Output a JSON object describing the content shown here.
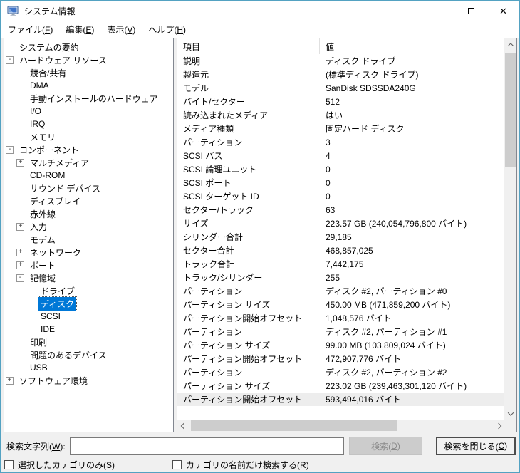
{
  "window": {
    "title": "システム情報",
    "close_glyph": "✕"
  },
  "menubar": {
    "items": [
      {
        "label": "ファイル(F)"
      },
      {
        "label": "編集(E)"
      },
      {
        "label": "表示(V)"
      },
      {
        "label": "ヘルプ(H)"
      }
    ]
  },
  "tree": {
    "items": [
      {
        "label": "システムの要約",
        "level": 0,
        "expander": ""
      },
      {
        "label": "ハードウェア リソース",
        "level": 0,
        "expander": "-"
      },
      {
        "label": "競合/共有",
        "level": 1,
        "expander": ""
      },
      {
        "label": "DMA",
        "level": 1,
        "expander": ""
      },
      {
        "label": "手動インストールのハードウェア",
        "level": 1,
        "expander": ""
      },
      {
        "label": "I/O",
        "level": 1,
        "expander": ""
      },
      {
        "label": "IRQ",
        "level": 1,
        "expander": ""
      },
      {
        "label": "メモリ",
        "level": 1,
        "expander": ""
      },
      {
        "label": "コンポーネント",
        "level": 0,
        "expander": "-"
      },
      {
        "label": "マルチメディア",
        "level": 1,
        "expander": "+"
      },
      {
        "label": "CD-ROM",
        "level": 1,
        "expander": ""
      },
      {
        "label": "サウンド デバイス",
        "level": 1,
        "expander": ""
      },
      {
        "label": "ディスプレイ",
        "level": 1,
        "expander": ""
      },
      {
        "label": "赤外線",
        "level": 1,
        "expander": ""
      },
      {
        "label": "入力",
        "level": 1,
        "expander": "+"
      },
      {
        "label": "モデム",
        "level": 1,
        "expander": ""
      },
      {
        "label": "ネットワーク",
        "level": 1,
        "expander": "+"
      },
      {
        "label": "ポート",
        "level": 1,
        "expander": "+"
      },
      {
        "label": "記憶域",
        "level": 1,
        "expander": "-"
      },
      {
        "label": "ドライブ",
        "level": 2,
        "expander": ""
      },
      {
        "label": "ディスク",
        "level": 2,
        "expander": "",
        "selected": true
      },
      {
        "label": "SCSI",
        "level": 2,
        "expander": ""
      },
      {
        "label": "IDE",
        "level": 2,
        "expander": ""
      },
      {
        "label": "印刷",
        "level": 1,
        "expander": ""
      },
      {
        "label": "問題のあるデバイス",
        "level": 1,
        "expander": ""
      },
      {
        "label": "USB",
        "level": 1,
        "expander": ""
      },
      {
        "label": "ソフトウェア環境",
        "level": 0,
        "expander": "+"
      }
    ]
  },
  "details": {
    "header": {
      "item": "項目",
      "value": "値"
    },
    "rows": [
      {
        "item": "説明",
        "value": "ディスク ドライブ"
      },
      {
        "item": "製造元",
        "value": "(標準ディスク ドライブ)"
      },
      {
        "item": "モデル",
        "value": "SanDisk SDSSDA240G"
      },
      {
        "item": "バイト/セクター",
        "value": "512"
      },
      {
        "item": "読み込まれたメディア",
        "value": "はい"
      },
      {
        "item": "メディア種類",
        "value": "固定ハード ディスク"
      },
      {
        "item": "パーティション",
        "value": "3"
      },
      {
        "item": "SCSI バス",
        "value": "4"
      },
      {
        "item": "SCSI 論理ユニット",
        "value": "0"
      },
      {
        "item": "SCSI ポート",
        "value": "0"
      },
      {
        "item": "SCSI ターゲット ID",
        "value": "0"
      },
      {
        "item": "セクター/トラック",
        "value": "63"
      },
      {
        "item": "サイズ",
        "value": "223.57 GB (240,054,796,800 バイト)"
      },
      {
        "item": "シリンダー合計",
        "value": "29,185"
      },
      {
        "item": "セクター合計",
        "value": "468,857,025"
      },
      {
        "item": "トラック合計",
        "value": "7,442,175"
      },
      {
        "item": "トラック/シリンダー",
        "value": "255"
      },
      {
        "item": "パーティション",
        "value": "ディスク #2, パーティション #0"
      },
      {
        "item": "パーティション サイズ",
        "value": "450.00 MB (471,859,200 バイト)"
      },
      {
        "item": "パーティション開始オフセット",
        "value": "1,048,576 バイト"
      },
      {
        "item": "パーティション",
        "value": "ディスク #2, パーティション #1"
      },
      {
        "item": "パーティション サイズ",
        "value": "99.00 MB (103,809,024 バイト)"
      },
      {
        "item": "パーティション開始オフセット",
        "value": "472,907,776 バイト"
      },
      {
        "item": "パーティション",
        "value": "ディスク #2, パーティション #2"
      },
      {
        "item": "パーティション サイズ",
        "value": "223.02 GB (239,463,301,120 バイト)"
      },
      {
        "item": "パーティション開始オフセット",
        "value": "593,494,016 バイト",
        "highlighted": true
      }
    ]
  },
  "search": {
    "label": "検索文字列(W):",
    "value": "",
    "search_button": "検索(D)",
    "search_button_enabled": false,
    "close_button": "検索を閉じる(C)"
  },
  "options": {
    "only_selected_category": {
      "label": "選択したカテゴリのみ(S)",
      "checked": false
    },
    "category_names_only": {
      "label": "カテゴリの名前だけ検索する(R)",
      "checked": false
    }
  },
  "colors": {
    "selection": "#0078d7",
    "window_border": "#53a2c2",
    "panel_border": "#828790"
  }
}
